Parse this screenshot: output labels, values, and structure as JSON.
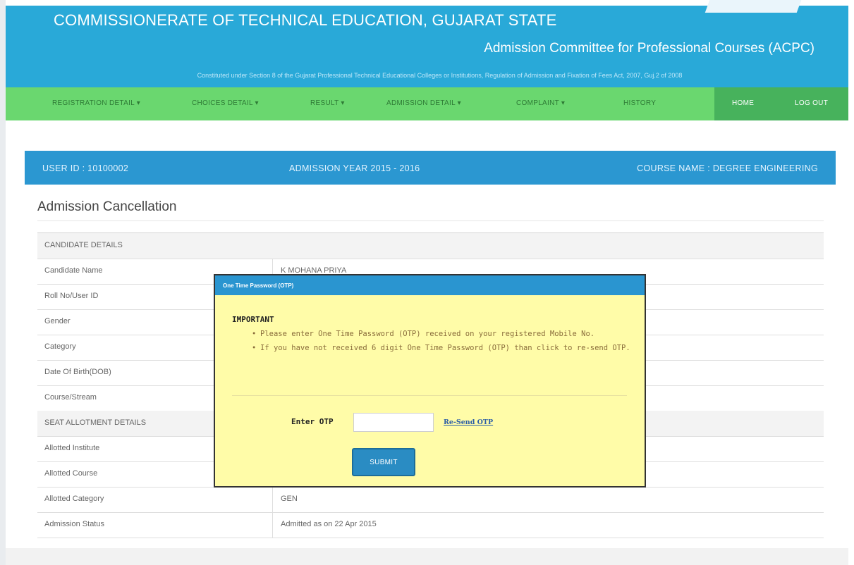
{
  "header": {
    "title": "COMMISSIONERATE OF TECHNICAL EDUCATION, GUJARAT STATE",
    "subtitle": "Admission Committee for Professional Courses (ACPC)",
    "act_text": "Constituted under Section 8 of the Gujarat Professional Technical Educational Colleges or Institutions, Regulation of Admission and Fixation of Fees Act, 2007, Guj.2 of 2008"
  },
  "nav": {
    "items": [
      {
        "label": "REGISTRATION DETAIL ▾"
      },
      {
        "label": "CHOICES DETAIL ▾"
      },
      {
        "label": "RESULT ▾"
      },
      {
        "label": "ADMISSION DETAIL ▾"
      },
      {
        "label": "COMPLAINT ▾"
      },
      {
        "label": "HISTORY"
      }
    ],
    "home": "HOME",
    "logout": "LOG OUT"
  },
  "info_bar": {
    "user_id": "USER ID : 10100002",
    "admission_year": "ADMISSION YEAR 2015 - 2016",
    "course_name": "COURSE NAME : DEGREE ENGINEERING"
  },
  "page_title": "Admission Cancellation",
  "table": {
    "section1": "CANDIDATE DETAILS",
    "rows1": [
      {
        "label": "Candidate Name",
        "value": "K MOHANA PRIYA"
      },
      {
        "label": "Roll No/User ID",
        "value": ""
      },
      {
        "label": "Gender",
        "value": ""
      },
      {
        "label": "Category",
        "value": ""
      },
      {
        "label": "Date Of Birth(DOB)",
        "value": ""
      },
      {
        "label": "Course/Stream",
        "value": ""
      }
    ],
    "section2": "SEAT ALLOTMENT DETAILS",
    "rows2": [
      {
        "label": "Allotted Institute",
        "value": ""
      },
      {
        "label": "Allotted Course",
        "value": ""
      },
      {
        "label": "Allotted Category",
        "value": "GEN"
      },
      {
        "label": "Admission Status",
        "value": "Admitted as on 22 Apr 2015"
      }
    ]
  },
  "modal": {
    "title": "One Time Password (OTP)",
    "important": "IMPORTANT",
    "bullets": [
      "Please enter One Time Password (OTP) received on your registered Mobile No.",
      "If you have not received 6 digit One Time Password (OTP) than click to re-send OTP."
    ],
    "otp_label": "Enter OTP",
    "otp_value": "",
    "resend": "Re-Send OTP",
    "submit": "SUBMIT"
  }
}
